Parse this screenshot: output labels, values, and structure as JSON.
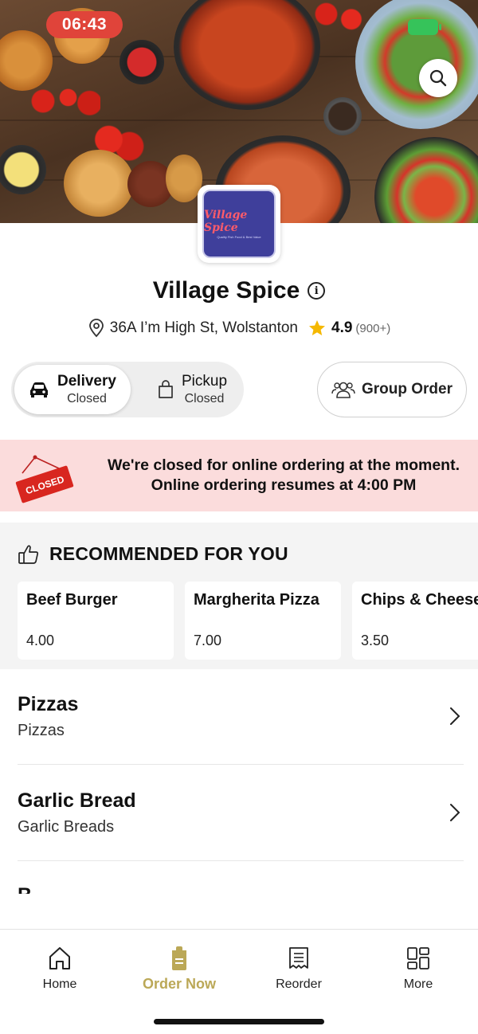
{
  "status_bar": {
    "time": "06:43"
  },
  "restaurant": {
    "logo_text": "Village Spice",
    "logo_tagline": "Quality Fish Food & Best Value",
    "name": "Village Spice",
    "address": "36A I’m High St, Wolstanton",
    "rating": "4.9",
    "rating_count": "(900+)"
  },
  "mode_toggle": {
    "delivery": {
      "label": "Delivery",
      "status": "Closed"
    },
    "pickup": {
      "label": "Pickup",
      "status": "Closed"
    }
  },
  "group_order": {
    "label": "Group Order"
  },
  "closed_banner": {
    "sign_text": "CLOSED",
    "line1": "We're closed for online ordering at the moment.",
    "line2": "Online ordering resumes at 4:00 PM"
  },
  "recommended": {
    "title": "RECOMMENDED FOR YOU",
    "items": [
      {
        "name": "Beef Burger",
        "price": "4.00"
      },
      {
        "name": "Margherita Pizza",
        "price": "7.00"
      },
      {
        "name": "Chips & Cheese",
        "price": "3.50"
      }
    ]
  },
  "categories": [
    {
      "name": "Pizzas",
      "subtitle": "Pizzas"
    },
    {
      "name": "Garlic Bread",
      "subtitle": "Garlic Breads"
    }
  ],
  "categories_peek": "B",
  "bottom_nav": [
    {
      "label": "Home",
      "icon": "home-icon"
    },
    {
      "label": "Order Now",
      "icon": "order-icon"
    },
    {
      "label": "Reorder",
      "icon": "receipt-icon"
    },
    {
      "label": "More",
      "icon": "grid-icon"
    }
  ],
  "colors": {
    "accent": "#bba857",
    "closed_red": "#e0443a",
    "banner_bg": "#fbdcdc",
    "star": "#f5b800"
  }
}
